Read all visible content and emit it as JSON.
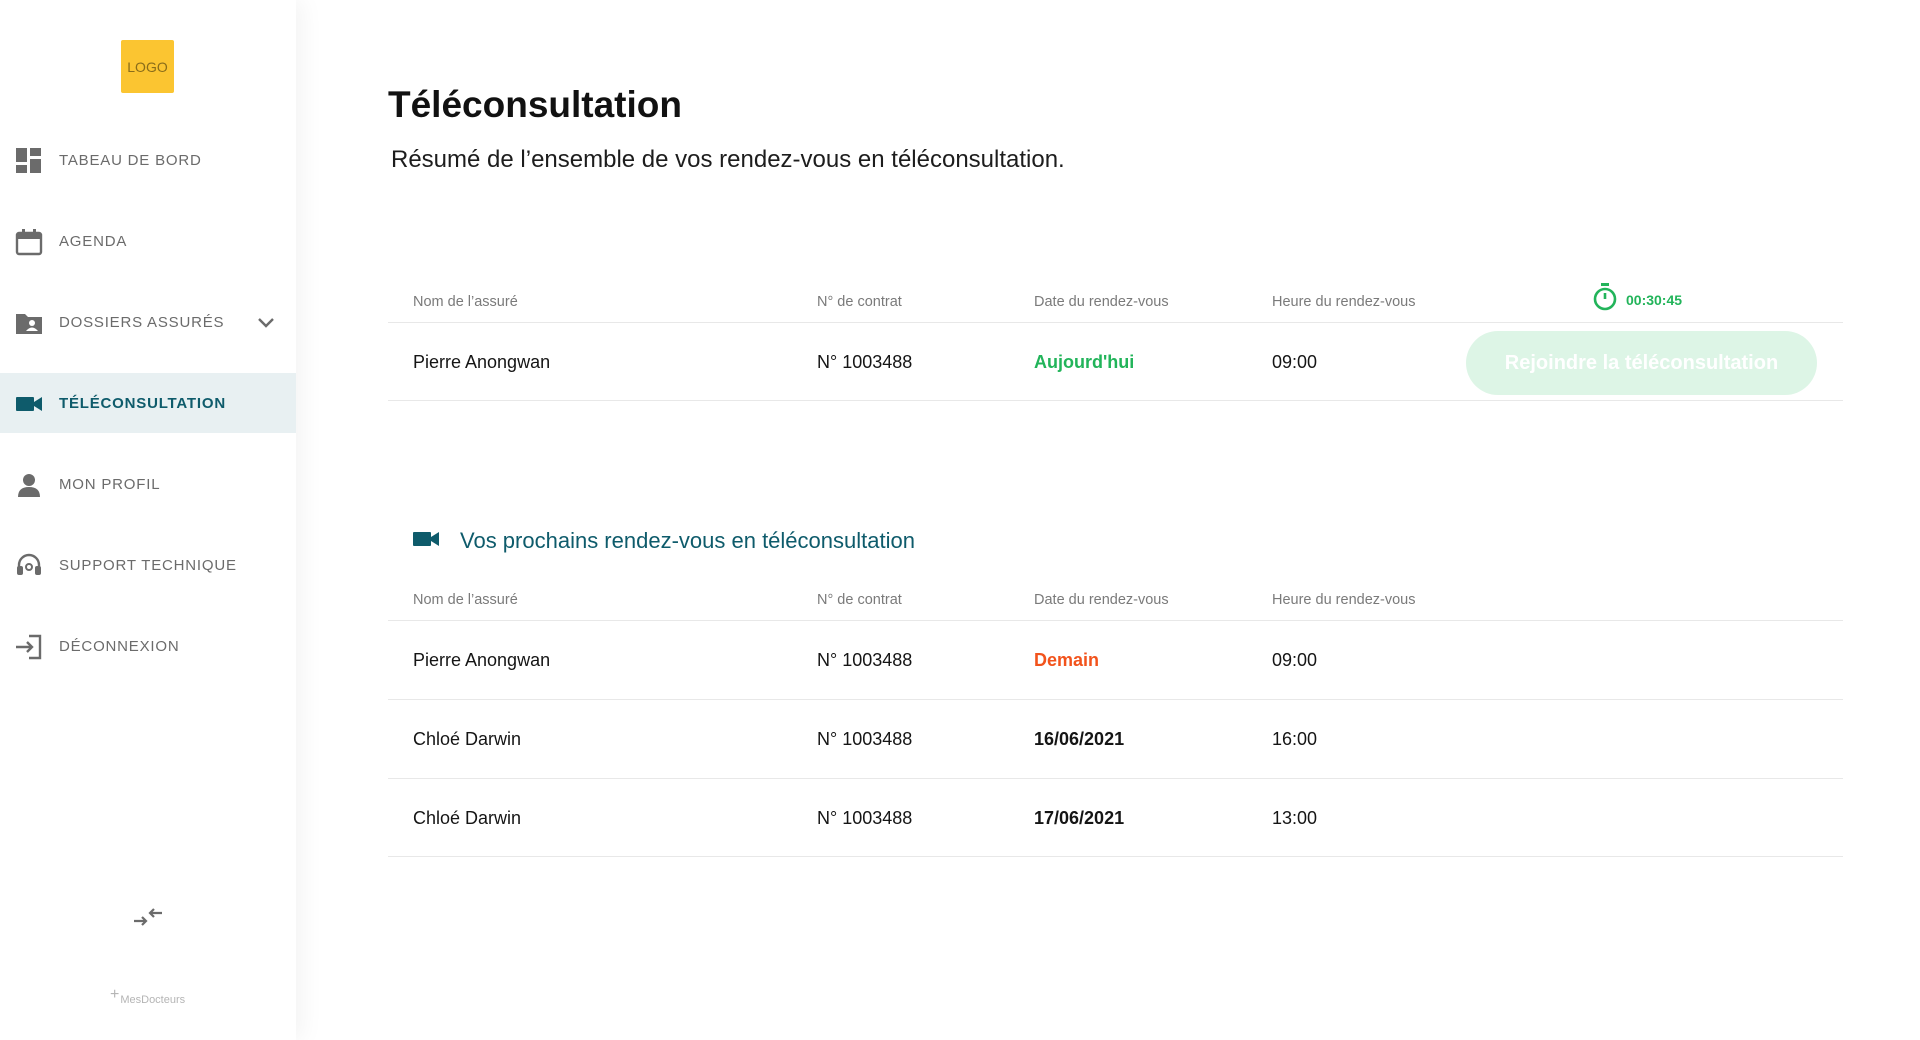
{
  "sidebar": {
    "logo_text": "LOGO",
    "items": [
      {
        "label": "TABEAU DE BORD",
        "icon": "dashboard-icon"
      },
      {
        "label": "AGENDA",
        "icon": "calendar-icon"
      },
      {
        "label": "DOSSIERS ASSURÉS",
        "icon": "folder-user-icon",
        "has_dropdown": true
      },
      {
        "label": "TÉLÉCONSULTATION",
        "icon": "video-camera-icon",
        "active": true
      },
      {
        "label": "MON PROFIL",
        "icon": "person-icon"
      },
      {
        "label": "SUPPORT TECHNIQUE",
        "icon": "headset-icon"
      },
      {
        "label": "DÉCONNEXION",
        "icon": "logout-icon"
      }
    ],
    "brand": "MesDocteurs"
  },
  "main": {
    "title": "Téléconsultation",
    "subtitle": "Résumé de l’ensemble de vos rendez-vous en téléconsultation.",
    "timer": "00:30:45",
    "current": {
      "headers": [
        "Nom de l’assuré",
        "N° de contrat",
        "Date du rendez-vous",
        "Heure du rendez-vous"
      ],
      "rows": [
        {
          "name": "Pierre Anongwan",
          "contract": "N° 1003488",
          "date": "Aujourd'hui",
          "time": "09:00"
        }
      ],
      "join_label": "Rejoindre la téléconsultation"
    },
    "upcoming": {
      "title": "Vos prochains rendez-vous en téléconsultation",
      "headers": [
        "Nom de l’assuré",
        "N° de contrat",
        "Date du rendez-vous",
        "Heure du rendez-vous"
      ],
      "rows": [
        {
          "name": "Pierre Anongwan",
          "contract": "N° 1003488",
          "date": "Demain",
          "time": "09:00"
        },
        {
          "name": "Chloé Darwin",
          "contract": "N° 1003488",
          "date": "16/06/2021",
          "time": "16:00"
        },
        {
          "name": "Chloé Darwin",
          "contract": "N° 1003488",
          "date": "17/06/2021",
          "time": "13:00"
        }
      ]
    }
  },
  "colors": {
    "accent": "#0E5B6B",
    "active_bg": "#E8F0F2",
    "success": "#22B45A",
    "warning": "#F2531C",
    "logo_bg": "#FBC531",
    "join_btn_bg": "#DDF5E6"
  }
}
